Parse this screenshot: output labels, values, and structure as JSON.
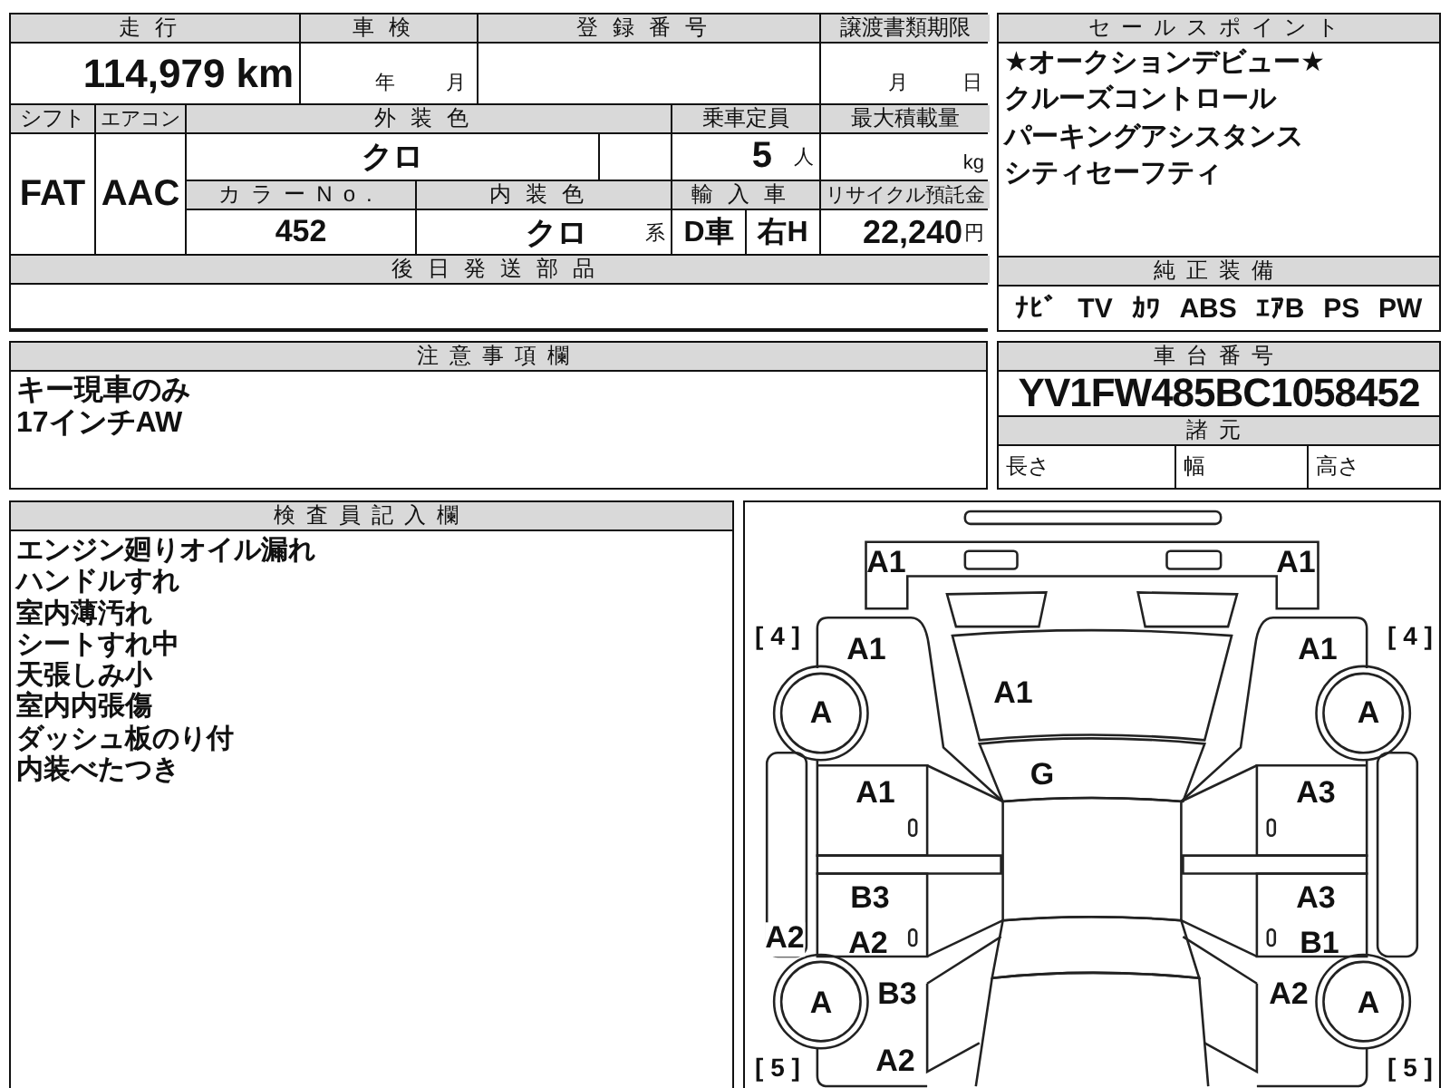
{
  "vehicle_table": {
    "mileage_label": "走行",
    "mileage": "114,979",
    "mileage_unit": "km",
    "shaken_label": "車検",
    "shaken_year_unit": "年",
    "shaken_month_unit": "月",
    "registration_label": "登録番号",
    "transfer_deadline_label": "譲渡書類期限",
    "transfer_month_unit": "月",
    "transfer_day_unit": "日",
    "shift_label": "シフト",
    "shift": "FAT",
    "aircon_label": "エアコン",
    "aircon": "AAC",
    "exterior_color_label": "外装色",
    "exterior_color": "クロ",
    "capacity_label": "乗車定員",
    "capacity": "5",
    "capacity_unit": "人",
    "max_load_label": "最大積載量",
    "max_load_unit": "kg",
    "color_no_label": "カラーNo.",
    "color_no": "452",
    "interior_color_label": "内装色",
    "interior_color": "クロ",
    "interior_color_suffix": "系",
    "import_label": "輸入車",
    "import_dealer": "D車",
    "steering": "右H",
    "recycle_label": "リサイクル預託金",
    "recycle_fee": "22,240",
    "recycle_unit": "円",
    "parts_later_label": "後日発送部品"
  },
  "sales_points": {
    "label": "セールスポイント",
    "items": [
      "★オークションデビュー★",
      "クルーズコントロール",
      "パーキングアシスタンス",
      "シティセーフティ"
    ]
  },
  "equipment": {
    "label": "純正装備",
    "items": [
      "ﾅﾋﾞ",
      "TV",
      "ｶﾜ",
      "ABS",
      "ｴｱB",
      "PS",
      "PW"
    ]
  },
  "notes": {
    "label": "注意事項欄",
    "lines": [
      "キー現車のみ",
      "17インチAW"
    ]
  },
  "chassis": {
    "label": "車台番号",
    "number": "YV1FW485BC1058452",
    "specs_label": "諸元",
    "specs": [
      "長さ",
      "幅",
      "高さ"
    ]
  },
  "inspector": {
    "label": "検査員記入欄",
    "lines": [
      "エンジン廻りオイル漏れ",
      "ハンドルすれ",
      "室内薄汚れ",
      "シートすれ中",
      "天張しみ小",
      "室内内張傷",
      "ダッシュ板のり付",
      "内装べたつき"
    ]
  },
  "diagram": {
    "marks": {
      "front_bumper_left": "A1",
      "front_bumper_right": "A1",
      "tire_front_left": "[ 4 ]",
      "tire_front_right": "[ 4 ]",
      "fender_left": "A1",
      "fender_right": "A1",
      "hood": "A1",
      "wheel_front_left": "A",
      "wheel_front_right": "A",
      "windshield": "G",
      "front_door_left": "A1",
      "front_door_right": "A3",
      "rear_door_left_upper": "B3",
      "rear_door_right_upper": "A3",
      "sill_left": "A2",
      "rear_door_left_lower": "A2",
      "rear_door_right_lower": "B1",
      "wheel_rear_left": "A",
      "quarter_left_upper": "B3",
      "quarter_right_upper": "A2",
      "wheel_rear_right": "A",
      "tire_rear_left": "[ 5 ]",
      "quarter_left_lower": "A2",
      "tire_rear_right": "[ 5 ]"
    }
  }
}
